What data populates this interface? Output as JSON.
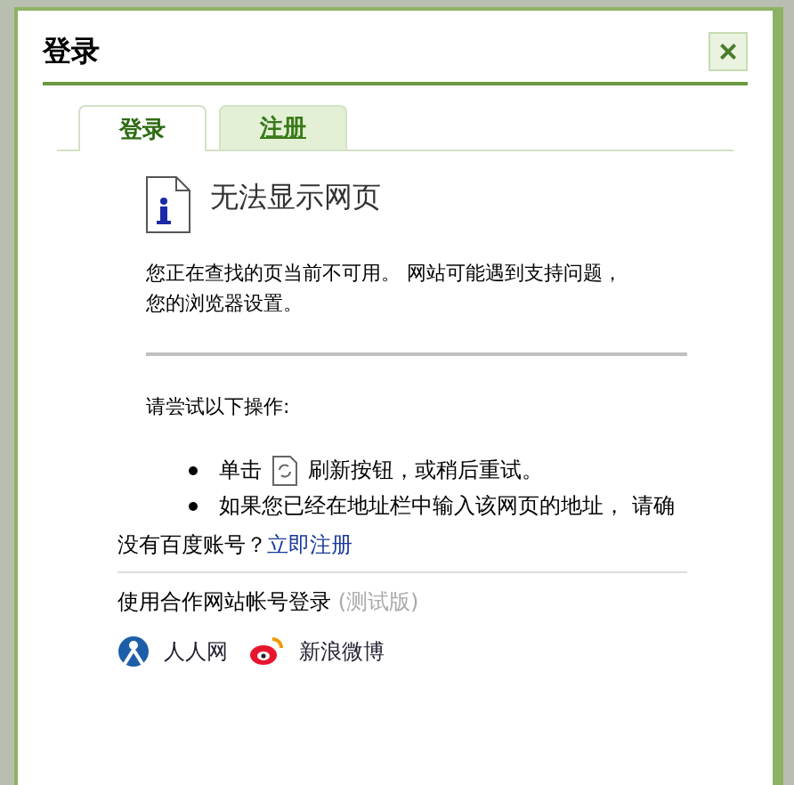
{
  "dialog": {
    "title": "登录",
    "close": "×"
  },
  "tabs": [
    {
      "label": "登录",
      "selected": true
    },
    {
      "label": "注册",
      "selected": false
    }
  ],
  "error_page": {
    "heading": "无法显示网页",
    "message": "您正在查找的页当前不可用。 网站可能遇到支持问题，",
    "message_line_2": "您的浏览器设置。",
    "try_label": "请尝试以下操作:",
    "steps": [
      {
        "kind": "refresh",
        "before": "单击",
        "after": "刷新按钮，或稍后重试。"
      },
      {
        "kind": "text",
        "text": "如果您已经在地址栏中输入该网页的地址， 请确"
      }
    ]
  },
  "signup": {
    "text": "没有百度账号？",
    "link": "立即注册"
  },
  "partner": {
    "label": "使用合作网站帐号登录",
    "note": "(测试版)",
    "sites": [
      {
        "kind": "renren",
        "name": "人人网"
      },
      {
        "kind": "weibo",
        "name": "新浪微博"
      }
    ]
  }
}
